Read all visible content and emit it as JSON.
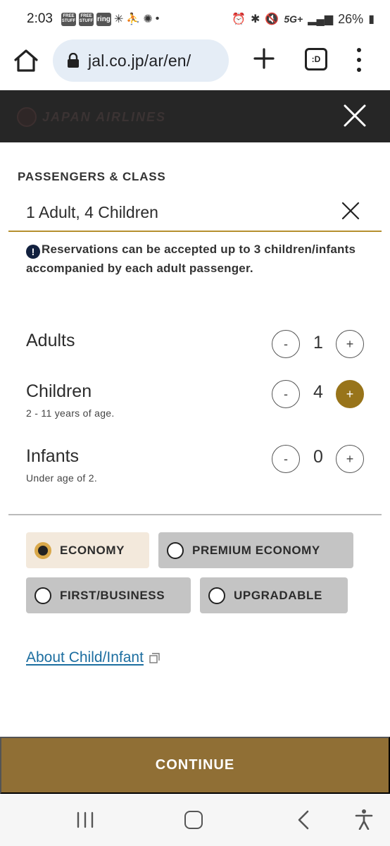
{
  "status_bar": {
    "time": "2:03",
    "badge_1": "FREE STUFF",
    "badge_2": "FREE STUFF",
    "badge_3": "ring",
    "network": "5G+",
    "battery": "26%"
  },
  "browser": {
    "url": "jal.co.jp/ar/en/",
    "tabs_label": ":D"
  },
  "site": {
    "brand": "JAPAN AIRLINES"
  },
  "panel": {
    "section_title": "PASSENGERS & CLASS",
    "summary": "1 Adult, 4 Children",
    "notice_icon": "!",
    "notice_text": "Reservations can be accepted up to 3 children/infants accompanied by each adult passenger."
  },
  "counters": {
    "adults": {
      "label": "Adults",
      "value": "1",
      "minus": "-",
      "plus": "+"
    },
    "children": {
      "label": "Children",
      "sub": "2 - 11 years of age.",
      "value": "4",
      "minus": "-",
      "plus": "+"
    },
    "infants": {
      "label": "Infants",
      "sub": "Under age of 2.",
      "value": "0",
      "minus": "-",
      "plus": "+"
    }
  },
  "classes": {
    "economy": "ECONOMY",
    "premium_economy": "PREMIUM ECONOMY",
    "first_business": "FIRST/BUSINESS",
    "upgradable": "UPGRADABLE",
    "selected": "economy"
  },
  "links": {
    "about_child": "About Child/Infant"
  },
  "actions": {
    "continue": "CONTINUE"
  },
  "colors": {
    "accent_gold": "#98741a",
    "continue_bg": "#906f35",
    "header_bg": "#262626",
    "link_blue": "#1c6ea0",
    "selected_bg": "#f3e9dc"
  }
}
